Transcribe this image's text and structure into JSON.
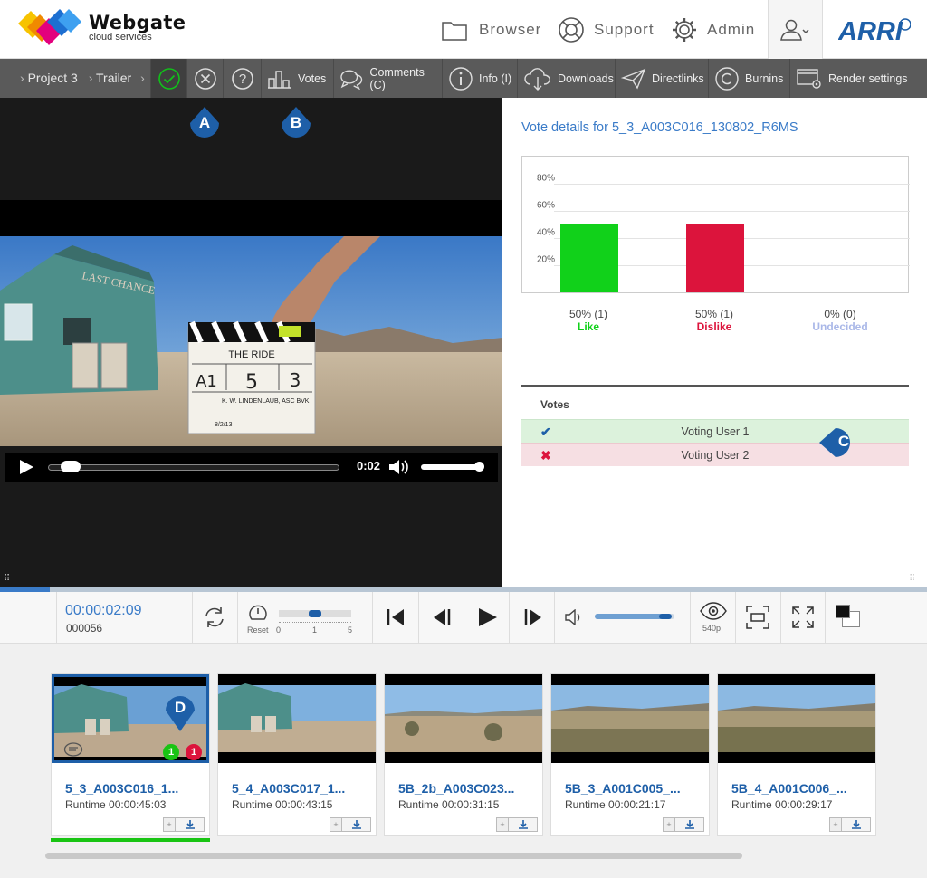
{
  "header": {
    "brand_name": "Webgate",
    "brand_sub": "cloud services",
    "nav": [
      {
        "label": "Browser",
        "icon": "folder-icon"
      },
      {
        "label": "Support",
        "icon": "lifebuoy-icon"
      },
      {
        "label": "Admin",
        "icon": "gear-icon"
      }
    ],
    "partner_logo": "ARRI"
  },
  "toolbar": {
    "breadcrumb": [
      "Project 3",
      "Trailer"
    ],
    "items": [
      {
        "label": "Votes",
        "icon": "bar-chart-icon"
      },
      {
        "label": "Comments (C)",
        "icon": "comments-icon"
      },
      {
        "label": "Info (I)",
        "icon": "info-icon"
      },
      {
        "label": "Downloads",
        "icon": "cloud-download-icon"
      },
      {
        "label": "Directlinks",
        "icon": "paper-plane-icon"
      },
      {
        "label": "Burnins",
        "icon": "copyright-icon"
      },
      {
        "label": "Render settings",
        "icon": "render-settings-icon"
      }
    ]
  },
  "callouts": [
    "A",
    "B",
    "C",
    "D"
  ],
  "video": {
    "time": "0:02",
    "slate": {
      "title": "THE RIDE",
      "roll": "A1",
      "scene": "5",
      "take": "3",
      "director": "K. W. LINDENLAUB, ASC BVK",
      "date": "8/2/13"
    }
  },
  "vote_panel": {
    "title": "Vote details for 5_3_A003C016_130802_R6MS",
    "votes_header": "Votes",
    "votes": [
      {
        "status": "like",
        "mark": "✔",
        "user": "Voting User 1"
      },
      {
        "status": "dislike",
        "mark": "✖",
        "user": "Voting User 2"
      }
    ]
  },
  "chart_data": {
    "type": "bar",
    "categories": [
      "Like",
      "Dislike",
      "Undecided"
    ],
    "values": [
      50,
      50,
      0
    ],
    "value_labels": [
      "50% (1)",
      "50% (1)",
      "0% (0)"
    ],
    "colors": [
      "#11d11a",
      "#dc143c",
      "#aab8e8"
    ],
    "yticks": [
      "20%",
      "40%",
      "60%",
      "80%"
    ],
    "ylim": [
      0,
      100
    ],
    "grid": true
  },
  "player": {
    "timecode": "00:00:02:09",
    "frame": "000056",
    "reset_label": "Reset",
    "speed_ticks": [
      "0",
      "1",
      "5"
    ],
    "speed_value": 1,
    "volume_level": 0.85,
    "quality": "540p"
  },
  "clips": [
    {
      "title": "5_3_A003C016_1...",
      "runtime": "Runtime 00:00:45:03",
      "selected": true,
      "likes": "1",
      "dislikes": "1"
    },
    {
      "title": "5_4_A003C017_1...",
      "runtime": "Runtime 00:00:43:15",
      "selected": false
    },
    {
      "title": "5B_2b_A003C023...",
      "runtime": "Runtime 00:00:31:15",
      "selected": false
    },
    {
      "title": "5B_3_A001C005_...",
      "runtime": "Runtime 00:00:21:17",
      "selected": false
    },
    {
      "title": "5B_4_A001C006_...",
      "runtime": "Runtime 00:00:29:17",
      "selected": false
    }
  ]
}
